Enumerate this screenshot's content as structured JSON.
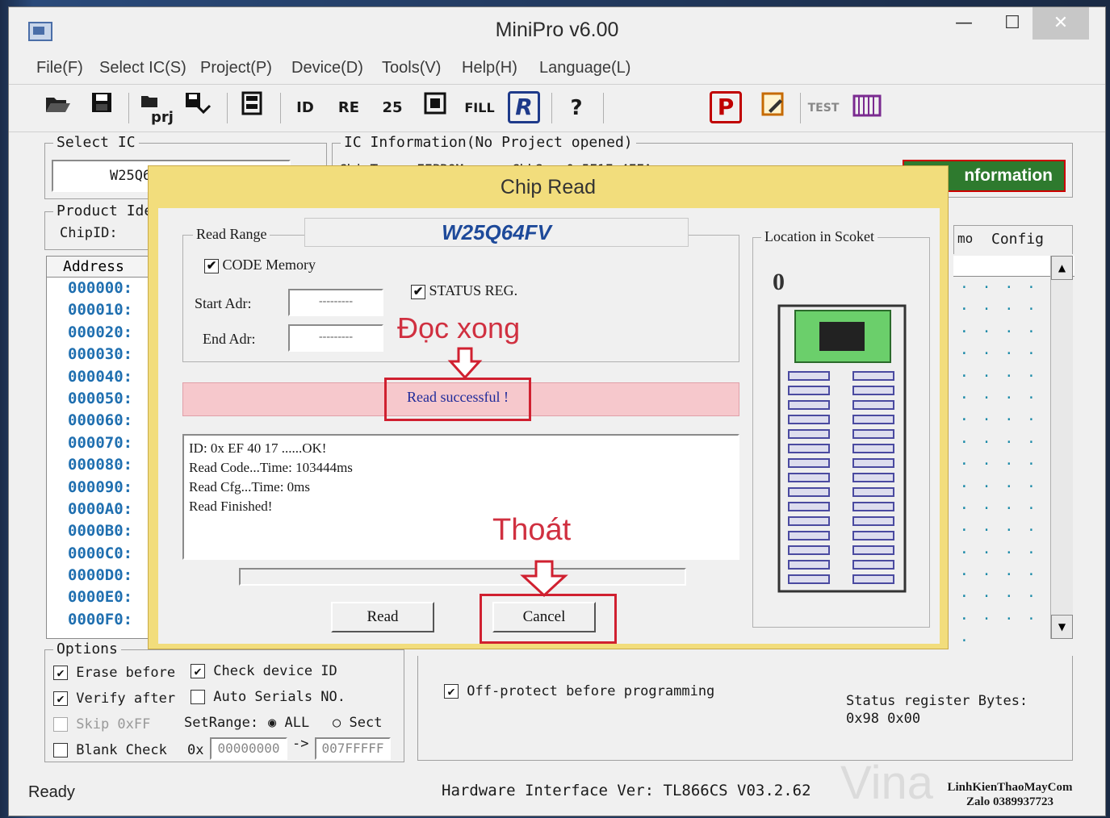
{
  "window": {
    "title": "MiniPro v6.00",
    "minimize": "—",
    "maximize": "☐",
    "close": "✕"
  },
  "menu": [
    "File(F)",
    "Select IC(S)",
    "Project(P)",
    "Device(D)",
    "Tools(V)",
    "Help(H)",
    "Language(L)"
  ],
  "toolbar": {
    "icons": [
      "open-icon",
      "save-icon",
      "project-icon",
      "save-project-icon",
      "chip-icon",
      "id-icon",
      "read-icon",
      "verify-icon",
      "program-icon",
      "fill-icon",
      "read-r-icon",
      "help-icon",
      "program-p-icon",
      "edit-icon",
      "test-icon",
      "socket-icon"
    ],
    "prj_label": "prj",
    "fill_label": "FILL",
    "r_label": "R",
    "p_label": "P",
    "test_label": "TEST",
    "help_label": "?"
  },
  "select_ic": {
    "title": "Select IC",
    "value": "W25Q64"
  },
  "ic_info": {
    "title": "IC Information(No Project opened)",
    "chip_type": "ChipType:  EEPROM",
    "chksum": "ChkSum:0x5E1F_4FFA",
    "info_button": "nformation"
  },
  "product_id": {
    "title": "Product Iden",
    "chip_id": "ChipID:"
  },
  "tabs": {
    "mo": "mo",
    "config": "Config"
  },
  "address_list": {
    "header": "Address",
    "rows": [
      "000000:",
      "000010:",
      "000020:",
      "000030:",
      "000040:",
      "000050:",
      "000060:",
      "000070:",
      "000080:",
      "000090:",
      "0000A0:",
      "0000B0:",
      "0000C0:",
      "0000D0:",
      "0000E0:",
      "0000F0:"
    ]
  },
  "dialog": {
    "title": "Chip Read",
    "read_range": "Read Range",
    "chip_name": "W25Q64FV",
    "code_memory": "CODE Memory",
    "status_reg": "STATUS REG.",
    "start_addr_label": "Start Adr:",
    "start_addr_value": "---------",
    "end_addr_label": "End Adr:",
    "end_addr_value": "---------",
    "status_message": "Read successful !",
    "log": [
      "ID: 0x EF 40 17 ......OK!",
      "Read Code...Time: 103444ms",
      "Read Cfg...Time: 0ms",
      "Read Finished!"
    ],
    "read_button": "Read",
    "cancel_button": "Cancel",
    "location_title": "Location in Scoket",
    "socket_label": "0"
  },
  "annotations": {
    "doc_xong": "Đọc xong",
    "thoat": "Thoát",
    "color": "#d02030"
  },
  "options": {
    "title": "Options",
    "erase_before": "Erase before",
    "check_device_id": "Check device ID",
    "verify_after": "Verify after",
    "auto_serials": "Auto Serials NO.",
    "skip_0xff": "Skip 0xFF",
    "set_range": "SetRange:",
    "range_all": "ALL",
    "range_sect": "Sect",
    "blank_check": "Blank Check",
    "ox": "0x",
    "range_start": "00000000",
    "range_arrow": "->",
    "range_end": "007FFFFF",
    "off_protect": "Off-protect before programming",
    "status_register_label": "Status register Bytes:",
    "status_register_value": "0x98 0x00"
  },
  "statusbar": {
    "ready": "Ready",
    "hardware": "Hardware Interface Ver: TL866CS V03.2.62",
    "watermark1": "LinhKienThaoMayCom",
    "watermark2": "Zalo 0389937723",
    "watermark3": "Vina"
  }
}
